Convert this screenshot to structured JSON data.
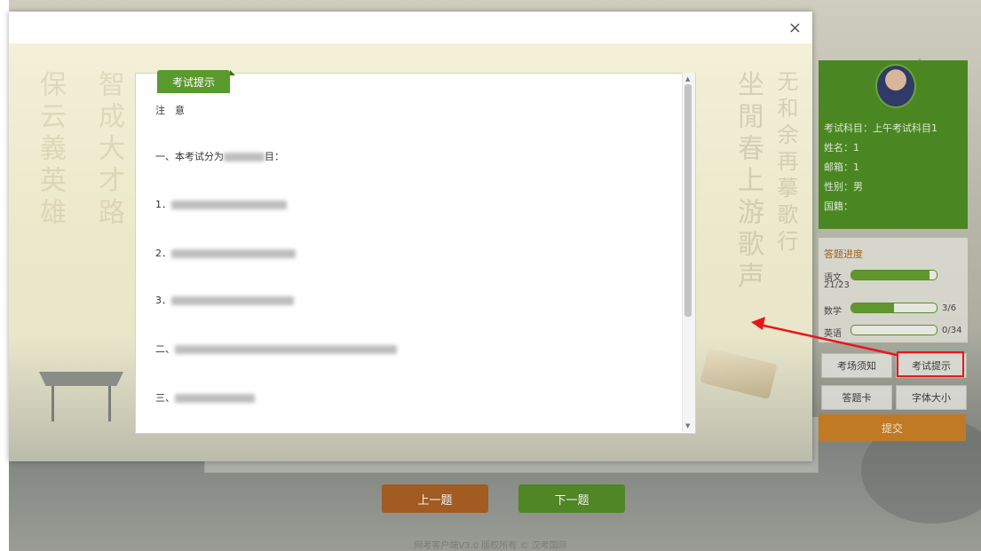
{
  "modal": {
    "close_icon": "×",
    "tag_label": "考试提示",
    "notice_title": "注　意",
    "line1": "一、本考试分为",
    "line1_suffix": "目：",
    "item1": "1．",
    "item2": "2．",
    "item3": "3．",
    "section2": "二、",
    "section3": "三、"
  },
  "profile": {
    "subject": "考试科目：上午考试科目1",
    "name": "姓名：1",
    "email": "邮箱：1",
    "gender": "性别：男",
    "nationality": "国籍："
  },
  "progress": {
    "title": "答题进度",
    "subjects": [
      {
        "label": "语文",
        "count": "21/23",
        "fraction": 0.913
      },
      {
        "label": "数学",
        "count": "3/6",
        "fraction": 0.5
      },
      {
        "label": "英语",
        "count": "0/34",
        "fraction": 0.0
      }
    ]
  },
  "buttons": {
    "exam_notice": "考场须知",
    "exam_tips": "考试提示",
    "answer_card": "答题卡",
    "font_size": "字体大小",
    "submit": "提交",
    "prev": "上一题",
    "next": "下一题"
  },
  "footer": "网考客户端V3.0 版权所有 © 汉考国际",
  "background_calligraphy": {
    "left1": "保云義英雄",
    "left2": "智成大才路",
    "right1": "坐閒春上游歌声",
    "right2": "无和余再摹歌行"
  },
  "colors": {
    "green": "#5a9a2c",
    "orange": "#c07a26",
    "highlight": "#e8161c"
  }
}
